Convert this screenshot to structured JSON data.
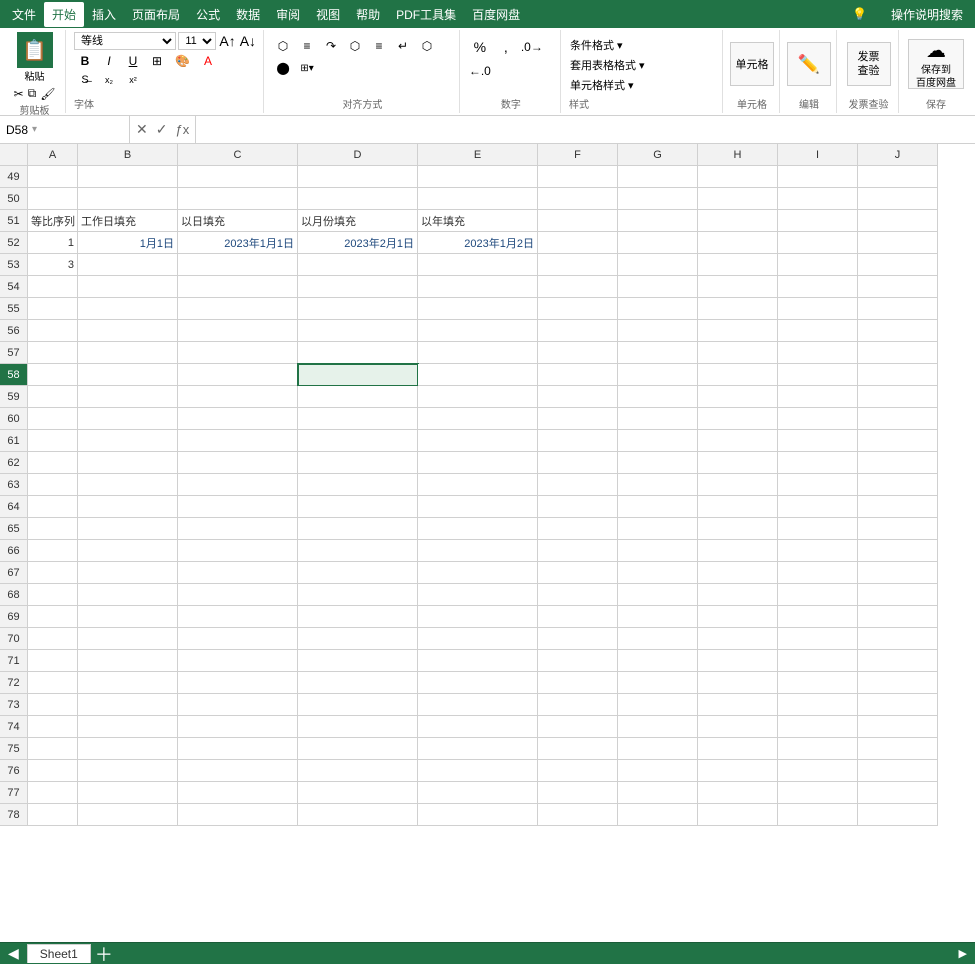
{
  "menubar": {
    "items": [
      "文件",
      "开始",
      "插入",
      "页面布局",
      "公式",
      "数据",
      "审阅",
      "视图",
      "帮助",
      "PDF工具集",
      "百度网盘"
    ],
    "active": "开始",
    "right_items": [
      "🔆",
      "操作说明搜索"
    ]
  },
  "toolbar": {
    "paste_label": "粘贴",
    "clipboard_label": "剪贴板",
    "font_name": "等线",
    "font_size": "11",
    "bold": "B",
    "italic": "I",
    "underline": "U",
    "font_label": "字体",
    "align_label": "对齐方式",
    "number_label": "数字",
    "styles_label": "样式",
    "conditional_format": "条件格式 ▾",
    "table_format": "套用表格格式 ▾",
    "cell_style": "单元格样式 ▾",
    "cell_label": "单元格",
    "cell_btn": "单元格",
    "edit_label": "编辑",
    "edit_btn": "编辑",
    "invoice_label": "发票查验",
    "invoice_btn1": "发票",
    "invoice_btn2": "查验",
    "save_label": "保存",
    "save_btn": "保存到\n百度网盘"
  },
  "formula_bar": {
    "cell_ref": "D58",
    "formula": ""
  },
  "columns": [
    "A",
    "B",
    "C",
    "D",
    "E",
    "F",
    "G",
    "H",
    "I",
    "J"
  ],
  "rows": {
    "start": 49,
    "data": [
      {
        "num": 49,
        "cells": [
          "",
          "",
          "",
          "",
          "",
          "",
          "",
          "",
          "",
          ""
        ]
      },
      {
        "num": 50,
        "cells": [
          "",
          "",
          "",
          "",
          "",
          "",
          "",
          "",
          "",
          ""
        ]
      },
      {
        "num": 51,
        "cells": [
          "等比序列",
          "工作日填充",
          "以日填充",
          "以月份填充",
          "以年填充",
          "",
          "",
          "",
          "",
          ""
        ]
      },
      {
        "num": 52,
        "cells": [
          "1",
          "1月1日",
          "2023年1月1日",
          "2023年2月1日",
          "2023年1月2日",
          "",
          "",
          "",
          "",
          ""
        ]
      },
      {
        "num": 53,
        "cells": [
          "3",
          "",
          "",
          "",
          "",
          "",
          "",
          "",
          "",
          ""
        ]
      },
      {
        "num": 54,
        "cells": [
          "",
          "",
          "",
          "",
          "",
          "",
          "",
          "",
          "",
          ""
        ]
      },
      {
        "num": 55,
        "cells": [
          "",
          "",
          "",
          "",
          "",
          "",
          "",
          "",
          "",
          ""
        ]
      },
      {
        "num": 56,
        "cells": [
          "",
          "",
          "",
          "",
          "",
          "",
          "",
          "",
          "",
          ""
        ]
      },
      {
        "num": 57,
        "cells": [
          "",
          "",
          "",
          "",
          "",
          "",
          "",
          "",
          "",
          ""
        ]
      },
      {
        "num": 58,
        "cells": [
          "",
          "",
          "",
          "",
          "",
          "",
          "",
          "",
          "",
          ""
        ]
      },
      {
        "num": 59,
        "cells": [
          "",
          "",
          "",
          "",
          "",
          "",
          "",
          "",
          "",
          ""
        ]
      },
      {
        "num": 60,
        "cells": [
          "",
          "",
          "",
          "",
          "",
          "",
          "",
          "",
          "",
          ""
        ]
      },
      {
        "num": 61,
        "cells": [
          "",
          "",
          "",
          "",
          "",
          "",
          "",
          "",
          "",
          ""
        ]
      },
      {
        "num": 62,
        "cells": [
          "",
          "",
          "",
          "",
          "",
          "",
          "",
          "",
          "",
          ""
        ]
      },
      {
        "num": 63,
        "cells": [
          "",
          "",
          "",
          "",
          "",
          "",
          "",
          "",
          "",
          ""
        ]
      },
      {
        "num": 64,
        "cells": [
          "",
          "",
          "",
          "",
          "",
          "",
          "",
          "",
          "",
          ""
        ]
      },
      {
        "num": 65,
        "cells": [
          "",
          "",
          "",
          "",
          "",
          "",
          "",
          "",
          "",
          ""
        ]
      },
      {
        "num": 66,
        "cells": [
          "",
          "",
          "",
          "",
          "",
          "",
          "",
          "",
          "",
          ""
        ]
      },
      {
        "num": 67,
        "cells": [
          "",
          "",
          "",
          "",
          "",
          "",
          "",
          "",
          "",
          ""
        ]
      },
      {
        "num": 68,
        "cells": [
          "",
          "",
          "",
          "",
          "",
          "",
          "",
          "",
          "",
          ""
        ]
      },
      {
        "num": 69,
        "cells": [
          "",
          "",
          "",
          "",
          "",
          "",
          "",
          "",
          "",
          ""
        ]
      },
      {
        "num": 70,
        "cells": [
          "",
          "",
          "",
          "",
          "",
          "",
          "",
          "",
          "",
          ""
        ]
      },
      {
        "num": 71,
        "cells": [
          "",
          "",
          "",
          "",
          "",
          "",
          "",
          "",
          "",
          ""
        ]
      },
      {
        "num": 72,
        "cells": [
          "",
          "",
          "",
          "",
          "",
          "",
          "",
          "",
          "",
          ""
        ]
      },
      {
        "num": 73,
        "cells": [
          "",
          "",
          "",
          "",
          "",
          "",
          "",
          "",
          "",
          ""
        ]
      },
      {
        "num": 74,
        "cells": [
          "",
          "",
          "",
          "",
          "",
          "",
          "",
          "",
          "",
          ""
        ]
      },
      {
        "num": 75,
        "cells": [
          "",
          "",
          "",
          "",
          "",
          "",
          "",
          "",
          "",
          ""
        ]
      },
      {
        "num": 76,
        "cells": [
          "",
          "",
          "",
          "",
          "",
          "",
          "",
          "",
          "",
          ""
        ]
      },
      {
        "num": 77,
        "cells": [
          "",
          "",
          "",
          "",
          "",
          "",
          "",
          "",
          "",
          ""
        ]
      },
      {
        "num": 78,
        "cells": [
          "",
          "",
          "",
          "",
          "",
          "",
          "",
          "",
          "",
          ""
        ]
      }
    ]
  },
  "sheet_tab": "Sheet1",
  "status": {
    "scroll_hint": "◀"
  }
}
